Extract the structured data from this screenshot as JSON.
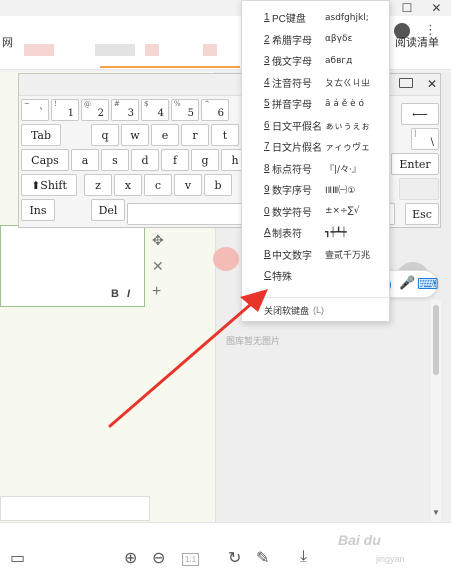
{
  "window": {
    "minimize": "—",
    "maximize": "☐",
    "close": "✕"
  },
  "topbar": {
    "left_text": "网",
    "right_text": "阅读清单"
  },
  "keyboard": {
    "close": "✕",
    "rows": [
      [
        {
          "s": "~",
          "m": "`"
        },
        {
          "s": "!",
          "m": "1"
        },
        {
          "s": "@",
          "m": "2"
        },
        {
          "s": "#",
          "m": "3"
        },
        {
          "s": "$",
          "m": "4"
        },
        {
          "s": "%",
          "m": "5"
        },
        {
          "s": "^",
          "m": "6"
        }
      ],
      [
        {
          "m": "Tab"
        },
        {
          "m": "q"
        },
        {
          "m": "w"
        },
        {
          "m": "e"
        },
        {
          "m": "r"
        },
        {
          "m": "t"
        },
        {
          "m": "y"
        }
      ],
      [
        {
          "m": "Caps"
        },
        {
          "m": "a"
        },
        {
          "m": "s"
        },
        {
          "m": "d"
        },
        {
          "m": "f"
        },
        {
          "m": "g"
        },
        {
          "m": "h"
        }
      ],
      [
        {
          "m": "⬆Shift"
        },
        {
          "m": "z"
        },
        {
          "m": "x"
        },
        {
          "m": "c"
        },
        {
          "m": "v"
        },
        {
          "m": "b"
        }
      ],
      [
        {
          "m": "Ins"
        },
        {
          "m": "Del"
        }
      ]
    ],
    "right_keys": {
      "backspace": "⟵",
      "pipe_upper": "|",
      "pipe_lower": "\\",
      "enter": "Enter",
      "esc": "Esc"
    }
  },
  "menu": {
    "items": [
      {
        "key": "1",
        "label": "PC键盘",
        "sample": "asdfghjkl;"
      },
      {
        "key": "2",
        "label": "希腊字母",
        "sample": "αβγδε"
      },
      {
        "key": "3",
        "label": "俄文字母",
        "sample": "абвгд"
      },
      {
        "key": "4",
        "label": "注音符号",
        "sample": "ㄆㄊㄍㄐㄓ"
      },
      {
        "key": "5",
        "label": "拼音字母",
        "sample": "ā á ě è ó"
      },
      {
        "key": "6",
        "label": "日文平假名",
        "sample": "ぁぃぅぇぉ"
      },
      {
        "key": "7",
        "label": "日文片假名",
        "sample": "ァィゥヴェ"
      },
      {
        "key": "8",
        "label": "标点符号",
        "sample": "『|/々·』"
      },
      {
        "key": "9",
        "label": "数字序号",
        "sample": "ⅠⅡⅢ㈠①"
      },
      {
        "key": "0",
        "label": "数学符号",
        "sample": "±×÷∑√"
      },
      {
        "key": "A",
        "label": "制表符",
        "sample": "┓┿┻┿"
      },
      {
        "key": "B",
        "label": "中文数字",
        "sample": "壹贰千万兆"
      },
      {
        "key": "C",
        "label": "特殊",
        "sample": ""
      }
    ],
    "close_label": "关闭软键盘",
    "close_hotkey": "(L)"
  },
  "ime": {
    "lang": "中",
    "punct": "°,",
    "mic": "🎤",
    "keyboard": "⌨"
  },
  "editor": {
    "bold": "B",
    "italic": "I"
  },
  "side_tools": {
    "move": "✥",
    "close": "✕",
    "add": "+"
  },
  "right_panel": {
    "no_image": "图库暂无图片"
  },
  "bottom_bar": {
    "layout": "▭",
    "zoom_in": "⊕",
    "zoom_out": "⊖",
    "fit": "1:1",
    "rotate": "↻",
    "edit": "✎",
    "download": "⤓"
  },
  "watermark": {
    "brand": "Bai du",
    "sub": "jingyan"
  },
  "colors": {
    "accent_blue": "#1e79d8",
    "arrow_red": "#e8352b",
    "editor_border": "#9bc491"
  }
}
